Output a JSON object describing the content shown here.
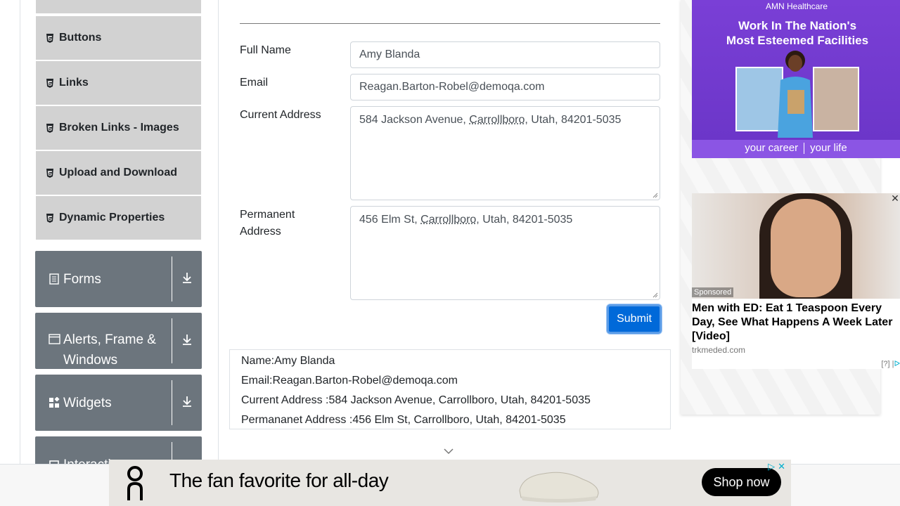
{
  "sidebar": {
    "elements_items": [
      {
        "label": "Buttons"
      },
      {
        "label": "Links"
      },
      {
        "label": "Broken Links - Images"
      },
      {
        "label": "Upload and Download"
      },
      {
        "label": "Dynamic Properties"
      }
    ],
    "groups": [
      {
        "label": "Forms",
        "icon": "form-icon"
      },
      {
        "label": "Alerts, Frame & Windows",
        "icon": "window-icon"
      },
      {
        "label": "Widgets",
        "icon": "widgets-icon"
      },
      {
        "label": "Interactions",
        "icon": "interactions-icon"
      }
    ]
  },
  "form": {
    "full_name_label": "Full Name",
    "full_name_value": "Amy Blanda",
    "email_label": "Email",
    "email_value": "Reagan.Barton-Robel@demoqa.com",
    "current_address_label": "Current Address",
    "current_address_pre": "584 Jackson Avenue, ",
    "current_address_city": "Carrollboro",
    "current_address_post": ", Utah, 84201-5035",
    "permanent_address_label_1": "Permanent",
    "permanent_address_label_2": "Address",
    "permanent_address_pre": "456 Elm St, ",
    "permanent_address_city": "Carrollboro",
    "permanent_address_post": ", Utah, 84201-5035",
    "submit_label": "Submit"
  },
  "output": {
    "name": "Name:Amy Blanda",
    "email": "Email:Reagan.Barton-Robel@demoqa.com",
    "current_address": "Current Address :584 Jackson Avenue, Carrollboro, Utah, 84201-5035",
    "permanent_address": "Permananet Address :456 Elm St, Carrollboro, Utah, 84201-5035"
  },
  "ads": {
    "amn": {
      "brand": "AMN Healthcare",
      "headline_1": "Work In The Nation's",
      "headline_2": "Most Esteemed Facilities",
      "band_left": "your career",
      "band_right": "your life"
    },
    "sponsored_ad": {
      "sponsored": "Sponsored",
      "title": "Men with ED: Eat 1 Teaspoon Every Day, See What Happens A Week Later [Video]",
      "domain": "trkmeded.com",
      "adchoice": "[?]"
    },
    "bottom": {
      "tagline": "The fan favorite for all-day",
      "cta": "Shop now"
    }
  },
  "colors": {
    "submit_bg": "#0069d9",
    "group_bg": "#6c757d",
    "menu_item_bg": "#d2d2d2",
    "amn_purple": "#7a3fd6"
  }
}
